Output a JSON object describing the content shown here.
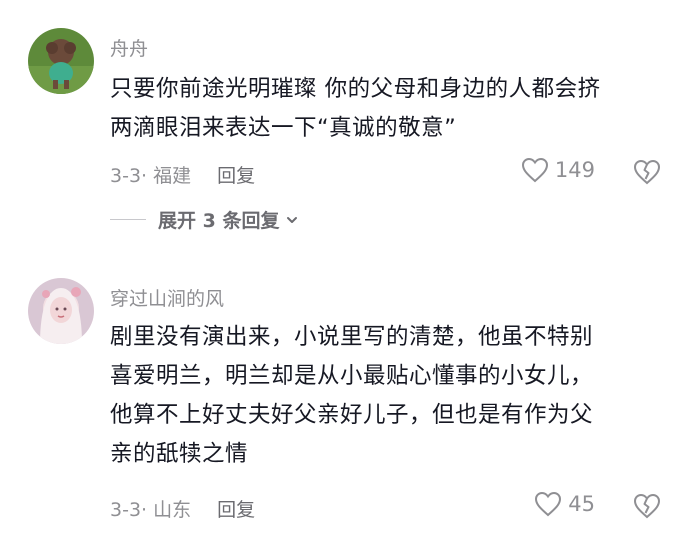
{
  "comments": [
    {
      "username": "舟舟",
      "lines": [
        "只要你前途光明璀璨 你的父母和身边的人都会挤",
        "两滴眼泪来表达一下“真诚的敬意”"
      ],
      "date": "3-3",
      "location": "福建",
      "reply_label": "回复",
      "likes": "149",
      "expand_label": "展开 3 条回复"
    },
    {
      "username": "穿过山涧的风",
      "lines": [
        "剧里没有演出来，小说里写的清楚，他虽不特别",
        "喜爱明兰，明兰却是从小最贴心懂事的小女儿，",
        "他算不上好丈夫好父亲好儿子，但也是有作为父",
        "亲的舐犊之情"
      ],
      "date": "3-3",
      "location": "山东",
      "reply_label": "回复",
      "likes": "45"
    }
  ],
  "colors": {
    "secondary_text": "#8f8f93",
    "primary_text": "#161823"
  },
  "icons": [
    "heart-outline-icon",
    "broken-heart-icon",
    "chevron-down-icon"
  ]
}
